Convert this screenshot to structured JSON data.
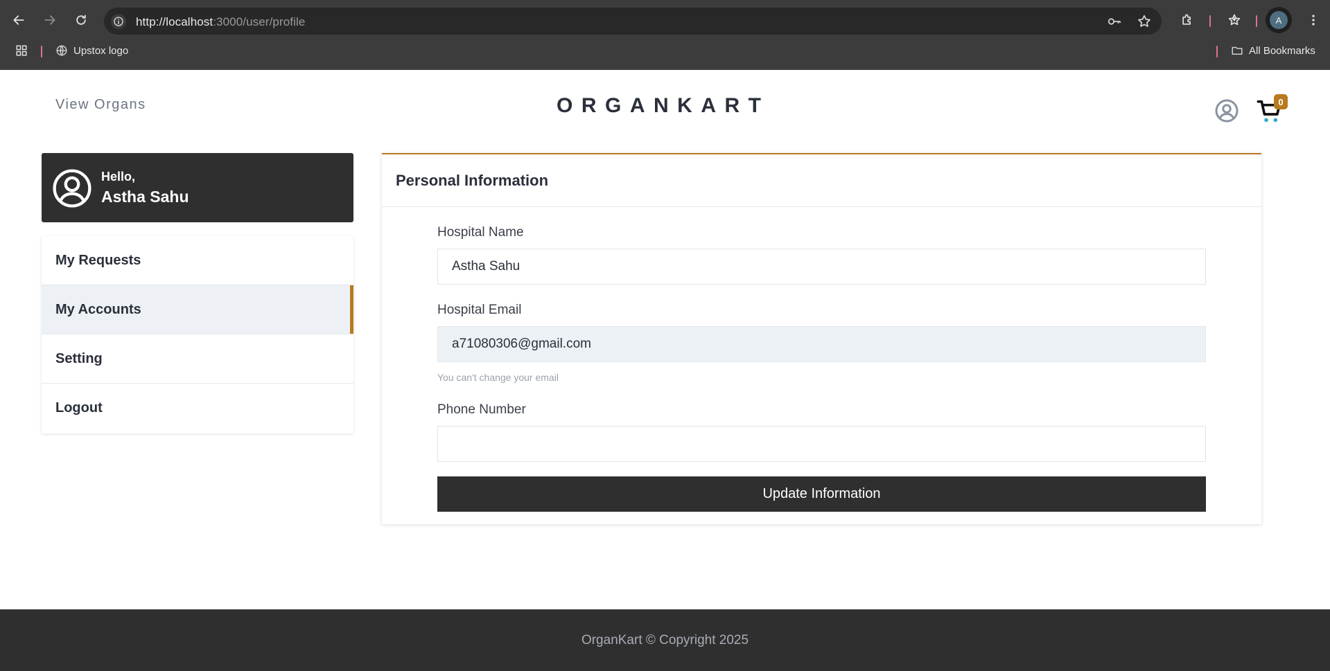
{
  "browser": {
    "url_host": "http://localhost",
    "url_path": ":3000/user/profile",
    "profile_initial": "A",
    "bookmarks": {
      "item": "Upstox logo",
      "all": "All Bookmarks"
    },
    "icons": [
      "back-icon",
      "forward-icon",
      "reload-icon",
      "site-info-icon",
      "password-key-icon",
      "bookmark-star-icon",
      "extensions-icon",
      "reading-list-icon",
      "more-menu-icon",
      "apps-grid-icon",
      "globe-icon",
      "folder-icon"
    ]
  },
  "header": {
    "nav_link": "View Organs",
    "brand": "ORGANKART",
    "cart_count": "0",
    "icons": [
      "user-circle-icon",
      "cart-icon"
    ]
  },
  "sidebar": {
    "greeting": "Hello,",
    "user_name": "Astha Sahu",
    "items": [
      {
        "label": "My Requests",
        "active": false
      },
      {
        "label": "My Accounts",
        "active": true
      },
      {
        "label": "Setting",
        "active": false
      },
      {
        "label": "Logout",
        "active": false
      }
    ]
  },
  "main": {
    "title": "Personal Information",
    "fields": {
      "hospital_name": {
        "label": "Hospital Name",
        "value": "Astha Sahu"
      },
      "hospital_email": {
        "label": "Hospital Email",
        "value": "a71080306@gmail.com",
        "hint": "You can't change your email"
      },
      "phone": {
        "label": "Phone Number",
        "value": ""
      }
    },
    "submit_label": "Update Information"
  },
  "footer": {
    "text": "OrganKart © Copyright 2025"
  },
  "colors": {
    "accent": "#b87a1f",
    "dark": "#2f2f2f",
    "active_bg": "#edf1f5"
  }
}
